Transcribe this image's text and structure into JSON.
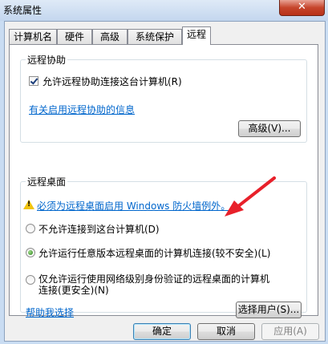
{
  "window": {
    "title": "系统属性",
    "close_glyph": "✕"
  },
  "tabs": [
    {
      "label": "计算机名"
    },
    {
      "label": "硬件"
    },
    {
      "label": "高级"
    },
    {
      "label": "系统保护"
    },
    {
      "label": "远程"
    }
  ],
  "remote_assistance": {
    "legend": "远程协助",
    "checkbox_label": "允许远程协助连接这台计算机(R)",
    "checked": true,
    "info_link": "有关启用远程协助的信息",
    "advanced_button": "高级(V)..."
  },
  "remote_desktop": {
    "legend": "远程桌面",
    "warning_link": "必须为远程桌面启用 Windows 防火墙例外。",
    "options": [
      {
        "label": "不允许连接到这台计算机(D)",
        "selected": false
      },
      {
        "label": "允许运行任意版本远程桌面的计算机连接(较不安全)(L)",
        "selected": true
      },
      {
        "label_line1": "仅允许运行使用网络级别身份验证的远程桌面的计算机",
        "label_line2": "连接(更安全)(N)",
        "selected": false
      }
    ],
    "help_link": "帮助我选择",
    "select_users_button": "选择用户(S)..."
  },
  "footer": {
    "ok": "确定",
    "cancel": "取消",
    "apply": "应用(A)"
  },
  "colors": {
    "annotation_arrow": "#e8202a",
    "link": "#0066cc"
  }
}
